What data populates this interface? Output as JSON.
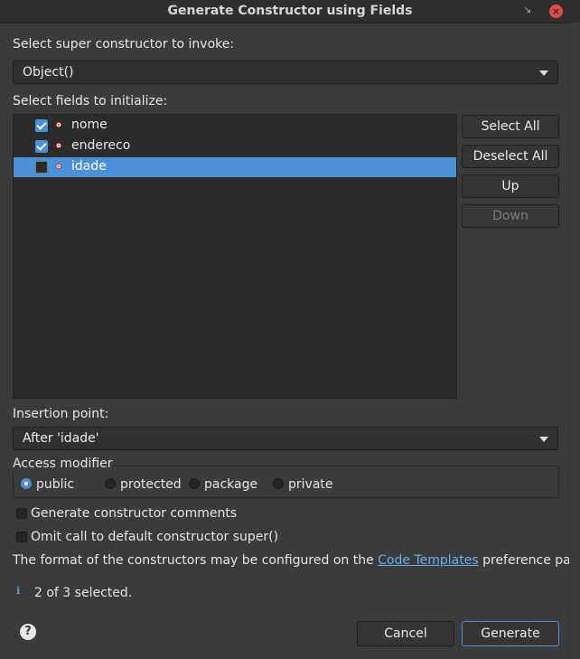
{
  "window": {
    "title": "Generate Constructor using Fields"
  },
  "super_constructor": {
    "label": "Select super constructor to invoke:",
    "value": "Object()"
  },
  "fields": {
    "label": "Select fields to initialize:",
    "items": [
      {
        "name": "nome",
        "checked": true,
        "selected": false
      },
      {
        "name": "endereco",
        "checked": true,
        "selected": false
      },
      {
        "name": "idade",
        "checked": false,
        "selected": true
      }
    ]
  },
  "side_buttons": {
    "select_all": "Select All",
    "deselect_all": "Deselect All",
    "up": "Up",
    "down": "Down"
  },
  "insertion": {
    "label": "Insertion point:",
    "value": "After 'idade'"
  },
  "access": {
    "label": "Access modifier",
    "options": [
      "public",
      "protected",
      "package",
      "private"
    ],
    "selected": "public"
  },
  "options": {
    "generate_comments": "Generate constructor comments",
    "omit_super": "Omit call to default constructor super()"
  },
  "info": {
    "text_before": "The format of the constructors may be configured on the ",
    "link": "Code Templates",
    "text_after": " preference page."
  },
  "status": {
    "text": "2 of 3 selected."
  },
  "footer": {
    "cancel": "Cancel",
    "generate": "Generate"
  },
  "colors": {
    "accent": "#4a90d9",
    "close": "#e04b4b",
    "link": "#6ab0f3"
  }
}
